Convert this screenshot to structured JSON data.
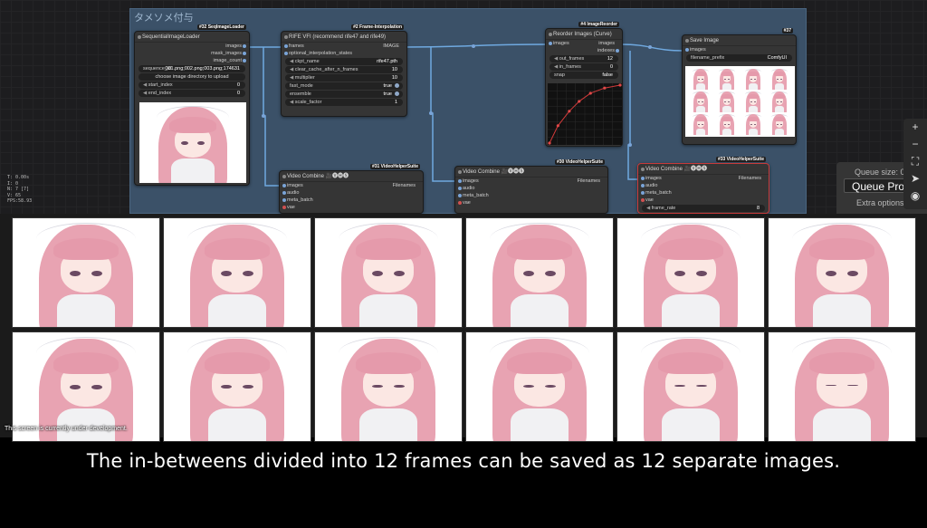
{
  "group": {
    "title": "タメソメ付与"
  },
  "nodes": {
    "loader": {
      "badge": "#32 SeqImageLoader",
      "title": "SequentialImageLoader",
      "outputs": [
        "images",
        "mask_images",
        "image_count"
      ],
      "sequence_id_label": "sequence_id",
      "sequence_id_value": "001.png;002.png;003.png;174631",
      "upload_button": "choose image directory to upload",
      "widgets": [
        {
          "label": "start_index",
          "value": "0"
        },
        {
          "label": "end_index",
          "value": "0"
        }
      ]
    },
    "rife": {
      "badge": "#2 Frame-Interpolation",
      "title": "RIFE VFI (recommend rife47 and rife49)",
      "inputs": [
        "frames",
        "optional_interpolation_states"
      ],
      "output": "IMAGE",
      "widgets": [
        {
          "label": "ckpt_name",
          "value": "rife47.pth"
        },
        {
          "label": "clear_cache_after_n_frames",
          "value": "10"
        },
        {
          "label": "multiplier",
          "value": "10"
        },
        {
          "label": "fast_mode",
          "value": "true"
        },
        {
          "label": "ensemble",
          "value": "true"
        },
        {
          "label": "scale_factor",
          "value": "1"
        }
      ]
    },
    "reorder": {
      "badge": "#4 ImageReorder",
      "title": "Reorder Images (Curve)",
      "input": "images",
      "outputs": [
        "images",
        "indexes"
      ],
      "widgets": [
        {
          "label": "out_frames",
          "value": "12"
        },
        {
          "label": "in_frames",
          "value": "0"
        },
        {
          "label": "snap",
          "value": "false"
        }
      ],
      "curve_points": [
        [
          0,
          0
        ],
        [
          0.12,
          0.3
        ],
        [
          0.28,
          0.55
        ],
        [
          0.42,
          0.72
        ],
        [
          0.58,
          0.86
        ],
        [
          0.78,
          0.95
        ],
        [
          1,
          1
        ]
      ]
    },
    "save": {
      "badge": "#37",
      "title": "Save Image",
      "input": "images",
      "widget_label": "filename_prefix",
      "widget_value": "ComfyUI"
    },
    "vc1": {
      "badge": "#31 VideoHelperSuite",
      "title": "Video Combine 🎥🅥🅗🅢",
      "inputs": [
        "images",
        "audio",
        "meta_batch",
        "vae"
      ],
      "output": "Filenames"
    },
    "vc2": {
      "badge": "#30 VideoHelperSuite",
      "title": "Video Combine 🎥🅥🅗🅢",
      "inputs": [
        "images",
        "audio",
        "meta_batch",
        "vae"
      ],
      "output": "Filenames"
    },
    "vc3": {
      "badge": "#33 VideoHelperSuite",
      "title": "Video Combine 🎥🅥🅗🅢",
      "inputs": [
        "images",
        "audio",
        "meta_batch",
        "vae"
      ],
      "output": "Filenames",
      "widget_label": "frame_rate",
      "widget_value": "8"
    }
  },
  "stats": [
    "T: 0.00s",
    "I: 0",
    "N: 7 [7]",
    "V: 65",
    "FPS:58.93"
  ],
  "queue": {
    "size_label": "Queue size: 0",
    "button": "Queue Prom",
    "extra": "Extra options"
  },
  "sidebar_icons": [
    "plus-icon",
    "minus-icon",
    "fit-icon",
    "arrow-icon",
    "eye-icon"
  ],
  "frames_count": 12,
  "dev_note": "This screen is currently under development.",
  "caption": "The in-betweens divided into 12 frames can be saved as 12 separate images."
}
